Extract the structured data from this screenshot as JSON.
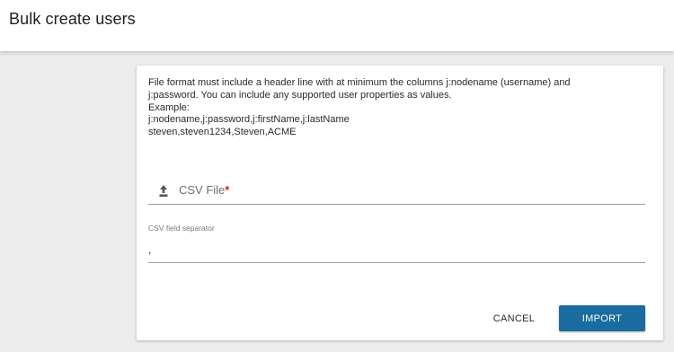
{
  "header": {
    "title": "Bulk create users"
  },
  "instructions": {
    "line1": "File format must include a header line with at minimum the columns j:nodename (username) and",
    "line2": "j:password. You can include any supported user properties as values.",
    "line3": "Example:",
    "line4": "j:nodename,j:password,j:firstName,j:lastName",
    "line5": "steven,steven1234,Steven,ACME"
  },
  "file_field": {
    "icon": "upload-icon",
    "label": "CSV File",
    "required_marker": "*"
  },
  "separator_field": {
    "label": "CSV field separator",
    "value": ","
  },
  "actions": {
    "cancel_label": "CANCEL",
    "import_label": "IMPORT"
  },
  "colors": {
    "primary": "#1a6ba0",
    "required": "#c62828",
    "background": "#ededed"
  }
}
